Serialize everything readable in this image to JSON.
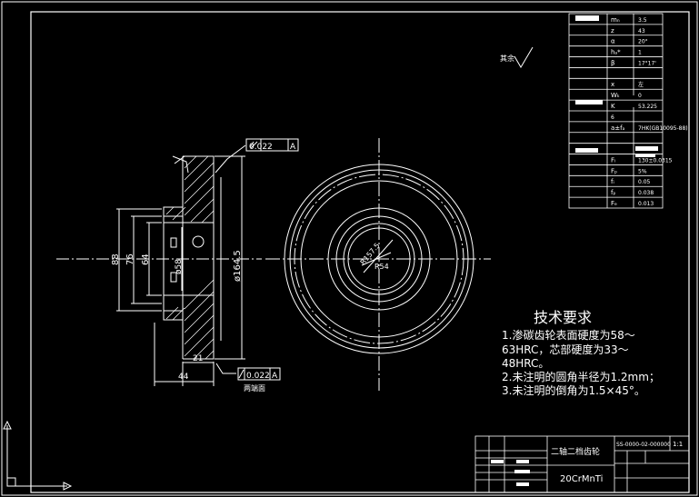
{
  "drawing": {
    "tech_title": "技术要求",
    "tech_lines": [
      "1.渗碳齿轮表面硬度为58～",
      "63HRC，芯部硬度为33～",
      "48HRC。",
      "2.未注明的圆角半径为1.2mm；",
      "3.未注明的倒角为1.5×45°。"
    ],
    "material": "20CrMnTi",
    "part_name": "二轴二档齿轮",
    "scale": "1:1",
    "drawing_no": "SS-0000-02-000000",
    "tolerance_top": "0.022",
    "tolerance_bottom": "0.022",
    "datum": "A",
    "roughness_other": "其余",
    "dims": {
      "d88": "88",
      "d76": "76",
      "d64": "64",
      "d58": "ø58",
      "d1645": "ø164.5",
      "w21": "21",
      "w44": "44",
      "r1575": "R157.5",
      "r54": "R54"
    },
    "bottom_label": "两端面",
    "param_values": [
      "3.5",
      "43",
      "20°",
      "1",
      "17°17'",
      "左",
      "0",
      "53.225",
      "6",
      "7HK(GB10095-88)",
      "130±0.0315",
      "5%",
      "0.05",
      "0.038",
      "0.013",
      "±0.016",
      "0.011"
    ],
    "param_symbols": [
      "mₙ",
      "z",
      "α",
      "hₐ*",
      "β",
      "",
      "x",
      "Wₖ",
      "K",
      "",
      "a±fₐ",
      "",
      "",
      "Fᵢ",
      "Fₚ",
      "fᵢ",
      "fₚ",
      "Fₑ"
    ]
  }
}
